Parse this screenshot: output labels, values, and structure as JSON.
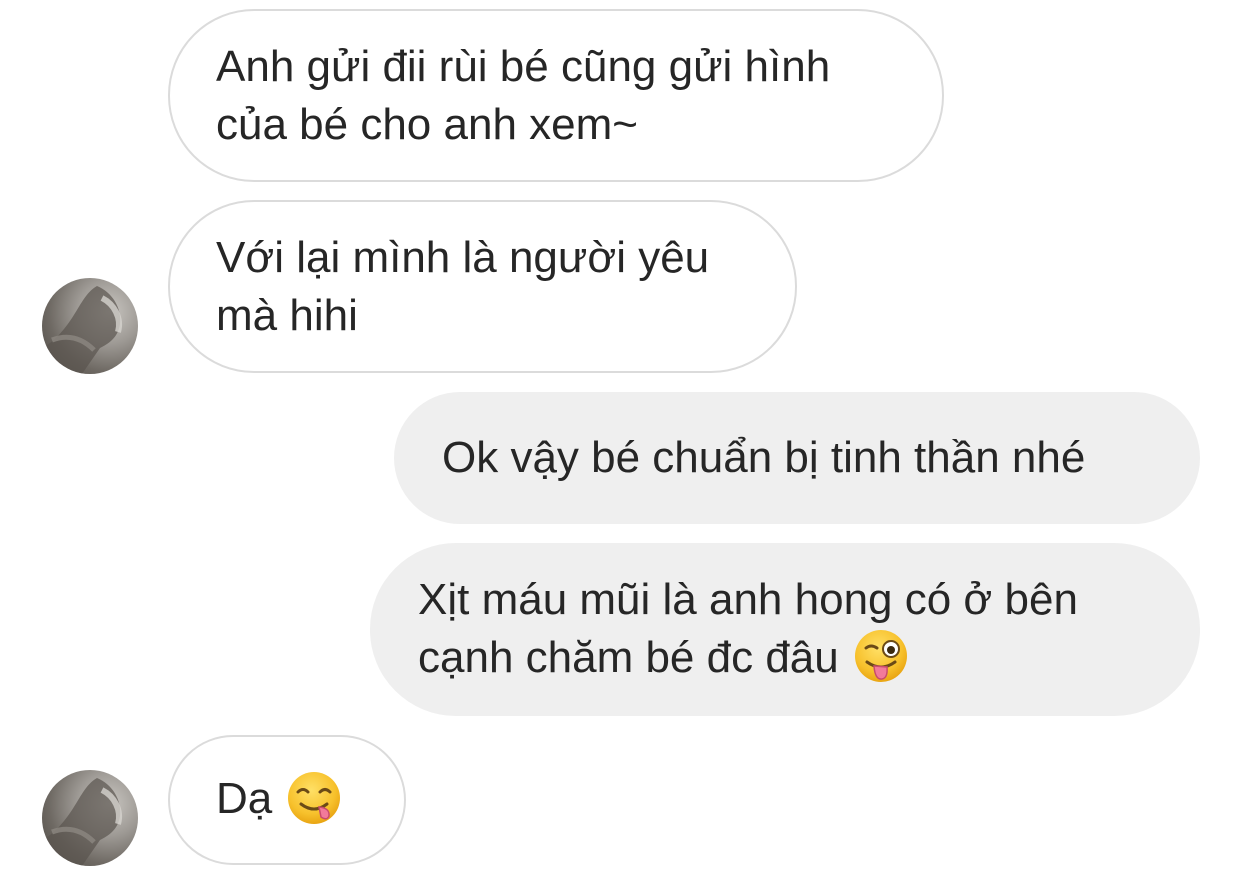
{
  "conversation": {
    "messages": [
      {
        "direction": "received",
        "text": "Anh gửi đii rùi bé cũng gửi hình\ncủa bé cho anh xem~"
      },
      {
        "direction": "received",
        "text": "Với lại mình là người yêu\nmà hihi"
      },
      {
        "direction": "sent",
        "text": "Ok vậy bé chuẩn bị tinh thần nhé"
      },
      {
        "direction": "sent",
        "text": "Xịt máu mũi là anh hong có ở bên\ncạnh chăm bé đc đâu",
        "emoji": "winking-face-with-tongue-icon"
      },
      {
        "direction": "received",
        "text": "Dạ",
        "emoji": "face-savoring-food-icon"
      }
    ]
  },
  "colors": {
    "received_bubble_bg": "#ffffff",
    "received_bubble_border": "#dbdbdb",
    "sent_bubble_bg": "#efefef",
    "text": "#262626",
    "emoji_yellow": "#f7c12c"
  }
}
